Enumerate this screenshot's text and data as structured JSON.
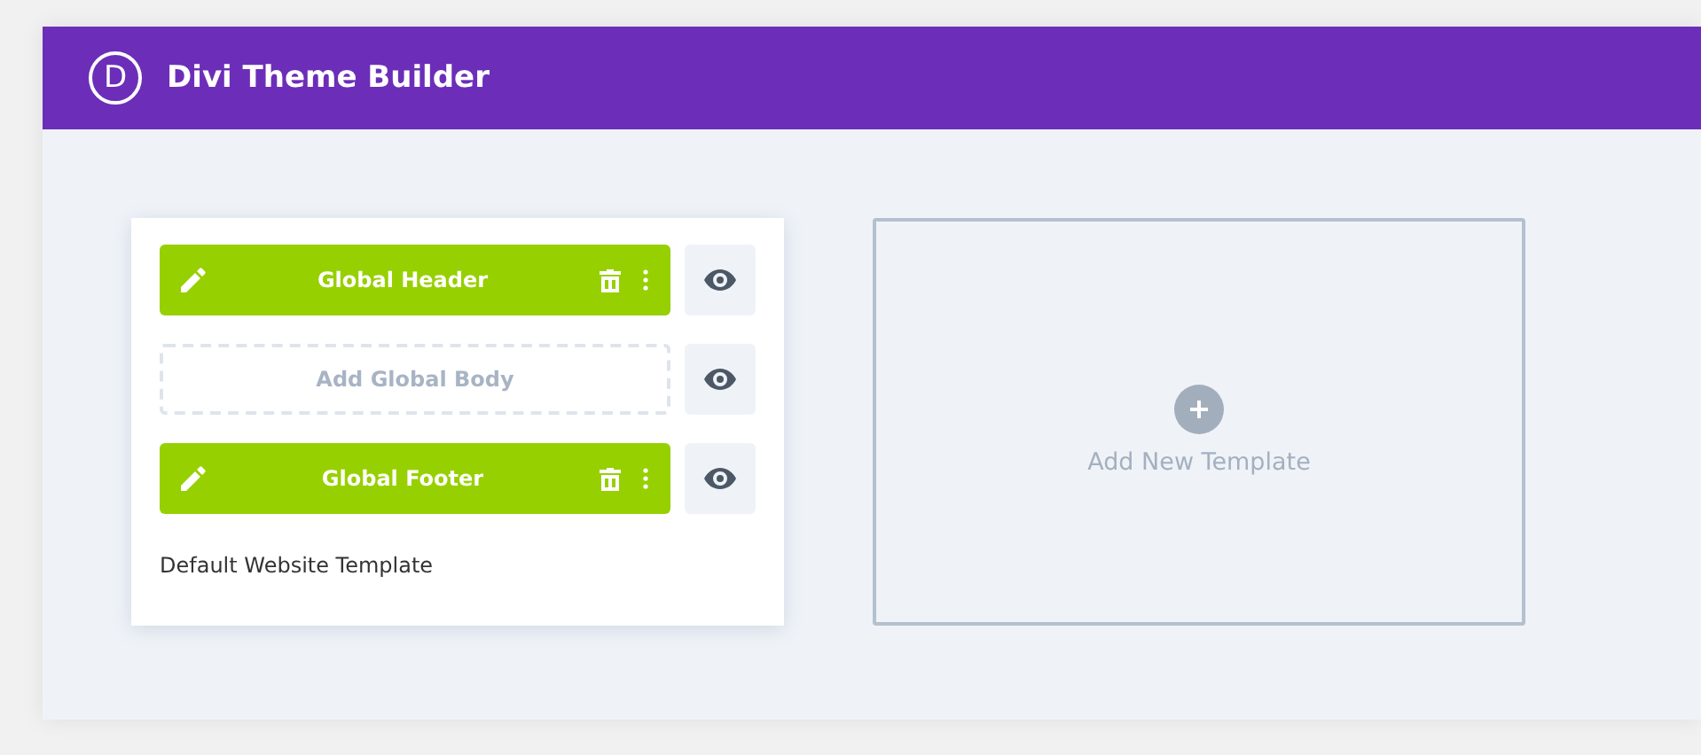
{
  "window": {
    "logo": "D",
    "title": "Divi Theme Builder"
  },
  "templates": [
    {
      "name": "Default Website Template",
      "slots": [
        {
          "kind": "assigned",
          "label": "Global Header"
        },
        {
          "kind": "empty",
          "label": "Add Global Body"
        },
        {
          "kind": "assigned",
          "label": "Global Footer"
        }
      ]
    }
  ],
  "add_template": {
    "label": "Add New Template"
  }
}
